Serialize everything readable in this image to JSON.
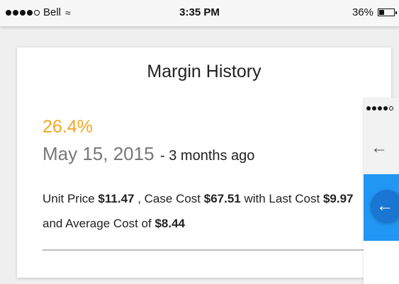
{
  "status_bar": {
    "carrier": "Bell",
    "time": "3:35 PM",
    "battery_percent": "36%",
    "battery_level": 0.36,
    "icons": [
      "signal-dots-icon",
      "wifi-icon",
      "battery-icon"
    ]
  },
  "card": {
    "title": "Margin History",
    "percent": "26.4%",
    "date": "May 15, 2015",
    "relative": "- 3 months ago",
    "details": {
      "t1": "Unit Price ",
      "unit_price": "$11.47",
      "t2": " , Case Cost ",
      "case_cost": "$67.51",
      "t3": " with Last Cost ",
      "last_cost": "$9.97",
      "t4": " and Average Cost of ",
      "average_cost": "$8.44"
    }
  },
  "overlay": {
    "icons": [
      "arrow-back-icon",
      "fab-arrow-back-icon"
    ]
  },
  "colors": {
    "accent_orange": "#f6a623",
    "blue": "#2196f3",
    "fab_blue": "#1976d2",
    "background": "#efefef"
  }
}
